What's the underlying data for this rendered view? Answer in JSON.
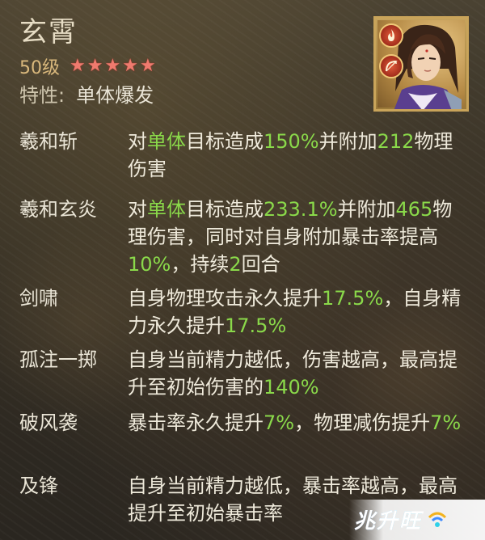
{
  "hero": {
    "name": "玄霄",
    "level": "50级",
    "stars": 5,
    "trait_label": "特性:",
    "trait_value": "单体爆发"
  },
  "portrait": {
    "badges": [
      "fire-icon",
      "bow-icon"
    ]
  },
  "skills": [
    {
      "name": "羲和斩",
      "desc": [
        {
          "t": "对"
        },
        {
          "t": "单体",
          "h": true
        },
        {
          "t": "目标造成"
        },
        {
          "t": "150%",
          "h": true
        },
        {
          "t": "并附加"
        },
        {
          "t": "212",
          "h": true
        },
        {
          "t": "物理伤害"
        }
      ]
    },
    {
      "name": "羲和玄炎",
      "desc": [
        {
          "t": "对"
        },
        {
          "t": "单体",
          "h": true
        },
        {
          "t": "目标造成"
        },
        {
          "t": "233.1%",
          "h": true
        },
        {
          "t": "并附加"
        },
        {
          "t": "465",
          "h": true
        },
        {
          "t": "物理伤害，同时对自身附加暴击率提高"
        },
        {
          "t": "10%",
          "h": true
        },
        {
          "t": "，持续"
        },
        {
          "t": "2",
          "h": true
        },
        {
          "t": "回合"
        }
      ]
    },
    {
      "name": "剑啸",
      "desc": [
        {
          "t": "自身物理攻击永久提升"
        },
        {
          "t": "17.5%",
          "h": true
        },
        {
          "t": "，自身精力永久提升"
        },
        {
          "t": "17.5%",
          "h": true
        }
      ]
    },
    {
      "name": "孤注一掷",
      "desc": [
        {
          "t": "自身当前精力越低，伤害越高，最高提升至初始伤害的"
        },
        {
          "t": "140%",
          "h": true
        }
      ]
    },
    {
      "name": "破风袭",
      "desc": [
        {
          "t": "暴击率永久提升"
        },
        {
          "t": "7%",
          "h": true
        },
        {
          "t": "，物理减伤提升"
        },
        {
          "t": "7%",
          "h": true
        }
      ]
    },
    {
      "name": "及锋",
      "desc": [
        {
          "t": "自身当前精力越低，暴击率越高，最高提升至初始暴击率"
        }
      ]
    }
  ],
  "watermark": {
    "text": "兆升旺"
  },
  "colors": {
    "highlight": "#8ad94a",
    "star": "#ef7a6e",
    "level": "#d9b87c"
  }
}
